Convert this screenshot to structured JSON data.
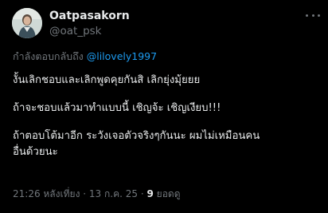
{
  "author": {
    "display_name": "Oatpasakorn",
    "handle": "@oat_psk"
  },
  "reply_context": {
    "prefix": "กำลังตอบกลับถึง",
    "mention": "@lilovely1997"
  },
  "tweet": {
    "paragraphs": [
      "งั้นเลิกชอบและเลิกพูดคุยกันสิ เลิกยุ่งมุ้ยยย",
      "ถ้าจะชอบแล้วมาทำแบบนี้ เชิญจ้ะ เชิญเงียบ!!!"
    ],
    "paragraph3_line1": "ถ้าตอบโต้มาอีก ระวังเจอตัวจริงๆกันนะ ผมไม่เหมือนคน",
    "paragraph3_line2": "อื่นด้วยนะ"
  },
  "meta": {
    "time": "21:26 หลังเที่ยง",
    "separator": "·",
    "date": "13 ก.ค. 25",
    "views_count": "9",
    "views_label": "ยอดดู"
  },
  "icons": {
    "more": "more-horizontal-icon",
    "avatar": "profile-avatar"
  },
  "colors": {
    "background": "#000000",
    "text_primary": "#e7e9ea",
    "text_secondary": "#71767b",
    "link": "#1d9bf0"
  }
}
